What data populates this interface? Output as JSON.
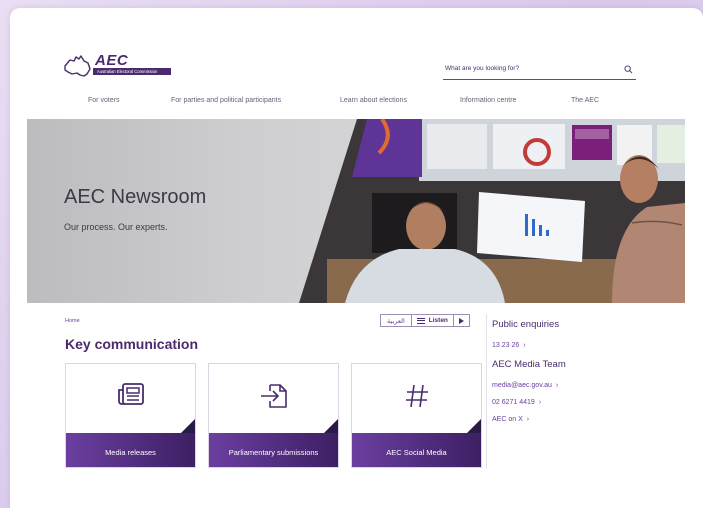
{
  "header": {
    "logo_text": "AEC",
    "logo_subtext": "Australian Electoral Commission",
    "search_placeholder": "What are you looking for?"
  },
  "nav": {
    "items": [
      {
        "label": "For voters"
      },
      {
        "label": "For parties and political participants"
      },
      {
        "label": "Learn about elections"
      },
      {
        "label": "Information centre"
      },
      {
        "label": "The AEC"
      }
    ]
  },
  "hero": {
    "title": "AEC Newsroom",
    "subtitle": "Our process. Our experts."
  },
  "breadcrumb": "Home",
  "language": {
    "arabic": "العربية",
    "listen": "Listen"
  },
  "section_title": "Key communication",
  "cards": [
    {
      "label": "Media releases",
      "icon": "newspaper-icon"
    },
    {
      "label": "Parliamentary submissions",
      "icon": "document-arrow-icon"
    },
    {
      "label": "AEC Social Media",
      "icon": "hashtag-icon"
    }
  ],
  "sidebar": {
    "public_heading": "Public enquiries",
    "public_phone": "13 23 26",
    "media_heading": "AEC Media Team",
    "links": [
      {
        "label": "media@aec.gov.au"
      },
      {
        "label": "02 6271 4419"
      },
      {
        "label": "AEC on X"
      }
    ]
  },
  "colors": {
    "brand_purple": "#4a2c6e",
    "accent_purple": "#6b3fa0"
  }
}
